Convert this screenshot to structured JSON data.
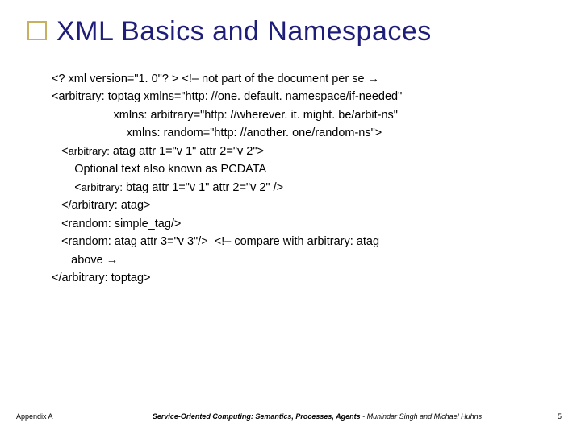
{
  "title": "XML Basics and Namespaces",
  "lines": {
    "l1": "<? xml version=\"1. 0\"? > <!– not part of the document per se →",
    "l2": "<arbitrary: toptag xmlns=\"http: //one. default. namespace/if-needed\"",
    "l3": "                   xmlns: arbitrary=\"http: //wherever. it. might. be/arbit-ns\"",
    "l4": "                       xmlns: random=\"http: //another. one/random-ns\">",
    "l5_pre": "   <",
    "l5_sm": "arbitrary:",
    "l5_post": " atag attr 1=\"v 1\" attr 2=\"v 2\">",
    "l6": "       Optional text also known as PCDATA",
    "l7_pre": "       <",
    "l7_sm": "arbitrary:",
    "l7_post": " btag attr 1=\"v 1\" attr 2=\"v 2\" />",
    "l8": "   </arbitrary: atag>",
    "l9": "   <random: simple_tag/>",
    "l10": "   <random: atag attr 3=\"v 3\"/>  <!– compare with arbitrary: atag",
    "l11": "      above →",
    "l12": "</arbitrary: toptag>"
  },
  "footer": {
    "left": "Appendix A",
    "book": "Service-Oriented Computing: Semantics, Processes, Agents",
    "authors": " - Munindar Singh and Michael Huhns",
    "page": "5"
  }
}
